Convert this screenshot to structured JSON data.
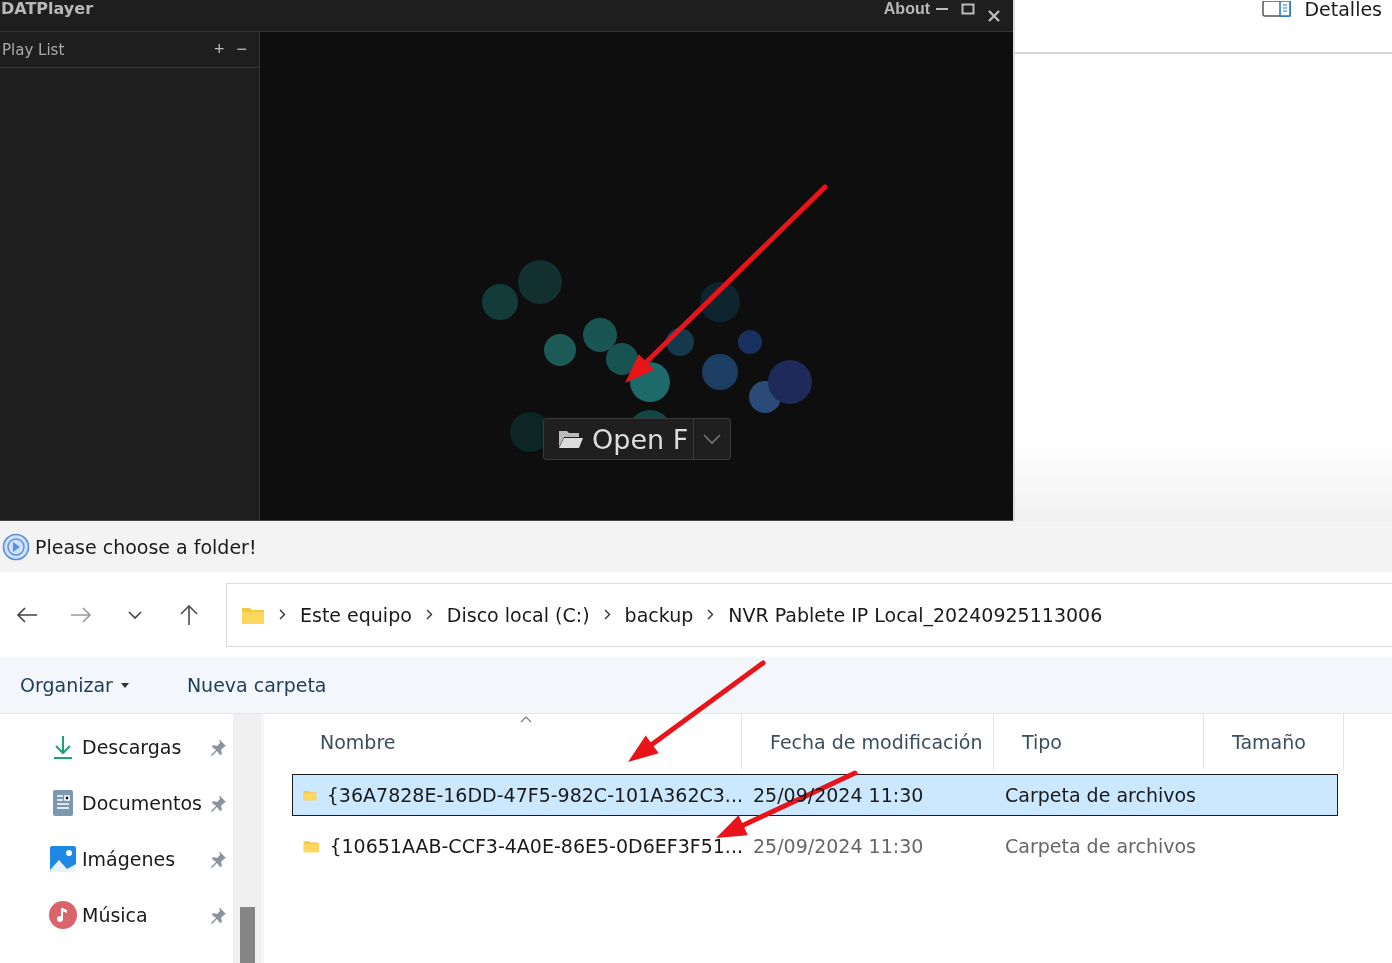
{
  "player": {
    "title": "DATPlayer",
    "about": "About",
    "playlist": {
      "title": "Play List",
      "add": "+",
      "remove": "−"
    },
    "open_button": "Open F"
  },
  "side_panel": {
    "details": "Detalles"
  },
  "dialog": {
    "title": "Please choose a folder!",
    "breadcrumb": [
      "Este equipo",
      "Disco local (C:)",
      "backup",
      "NVR Pablete IP Local_20240925113006"
    ],
    "toolbar": {
      "organize": "Organizar",
      "new_folder": "Nueva carpeta"
    },
    "sidebar": {
      "items": [
        {
          "label": "Descargas"
        },
        {
          "label": "Documentos"
        },
        {
          "label": "Imágenes"
        },
        {
          "label": "Música"
        }
      ]
    },
    "table": {
      "columns": [
        "Nombre",
        "Fecha de modificación",
        "Tipo",
        "Tamaño"
      ],
      "rows": [
        {
          "name": "{36A7828E-16DD-47F5-982C-101A362C3...",
          "modified": "25/09/2024 11:30",
          "type": "Carpeta de archivos",
          "selected": true
        },
        {
          "name": "{10651AAB-CCF3-4A0E-86E5-0D6EF3F51...",
          "modified": "25/09/2024 11:30",
          "type": "Carpeta de archivos",
          "selected": false
        }
      ]
    }
  }
}
